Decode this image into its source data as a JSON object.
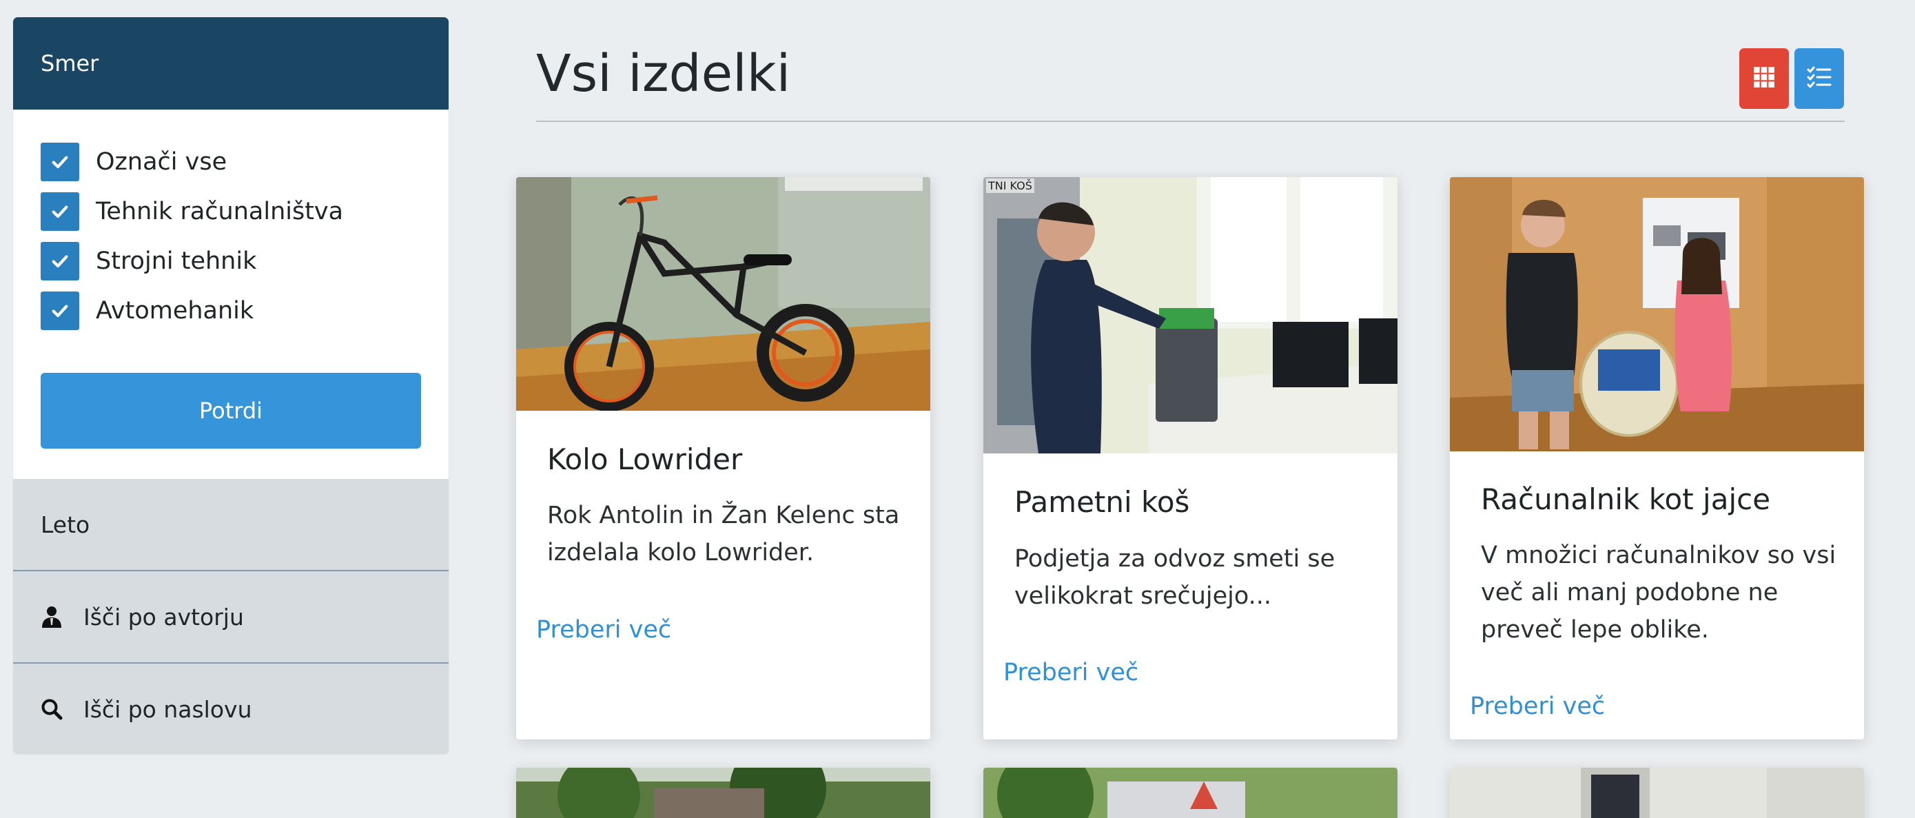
{
  "sidebar": {
    "header": "Smer",
    "checkboxes": [
      {
        "label": "Označi vse",
        "checked": true
      },
      {
        "label": "Tehnik računalništva",
        "checked": true
      },
      {
        "label": "Strojni tehnik",
        "checked": true
      },
      {
        "label": "Avtomehanik",
        "checked": true
      }
    ],
    "confirm_label": "Potrdi",
    "sections": {
      "year": "Leto",
      "author_search": "Išči po avtorju",
      "title_search": "Išči po naslovu"
    }
  },
  "main": {
    "title": "Vsi izdelki",
    "view_toggle": {
      "grid_icon": "grid-icon",
      "list_icon": "list-icon"
    },
    "cards": [
      {
        "title": "Kolo Lowrider",
        "description": "Rok Antolin in Žan Kelenc sta izdelala kolo Lowrider.",
        "link": "Preberi več"
      },
      {
        "title": "Pametni koš",
        "description": "Podjetja za odvoz smeti se velikokrat srečujejo...",
        "link": "Preberi več"
      },
      {
        "title": "Računalnik kot jajce",
        "description": "V množici računalnikov so vsi več ali manj podobne ne preveč lepe oblike.",
        "link": "Preberi več"
      }
    ],
    "image_overlay_text": "TNI KOŠ"
  },
  "colors": {
    "sidebar_header": "#1a4664",
    "checkbox": "#2a80bf",
    "confirm_button": "#3694da",
    "grid_button": "#e04536",
    "list_button": "#3493da",
    "link": "#3190d4"
  }
}
